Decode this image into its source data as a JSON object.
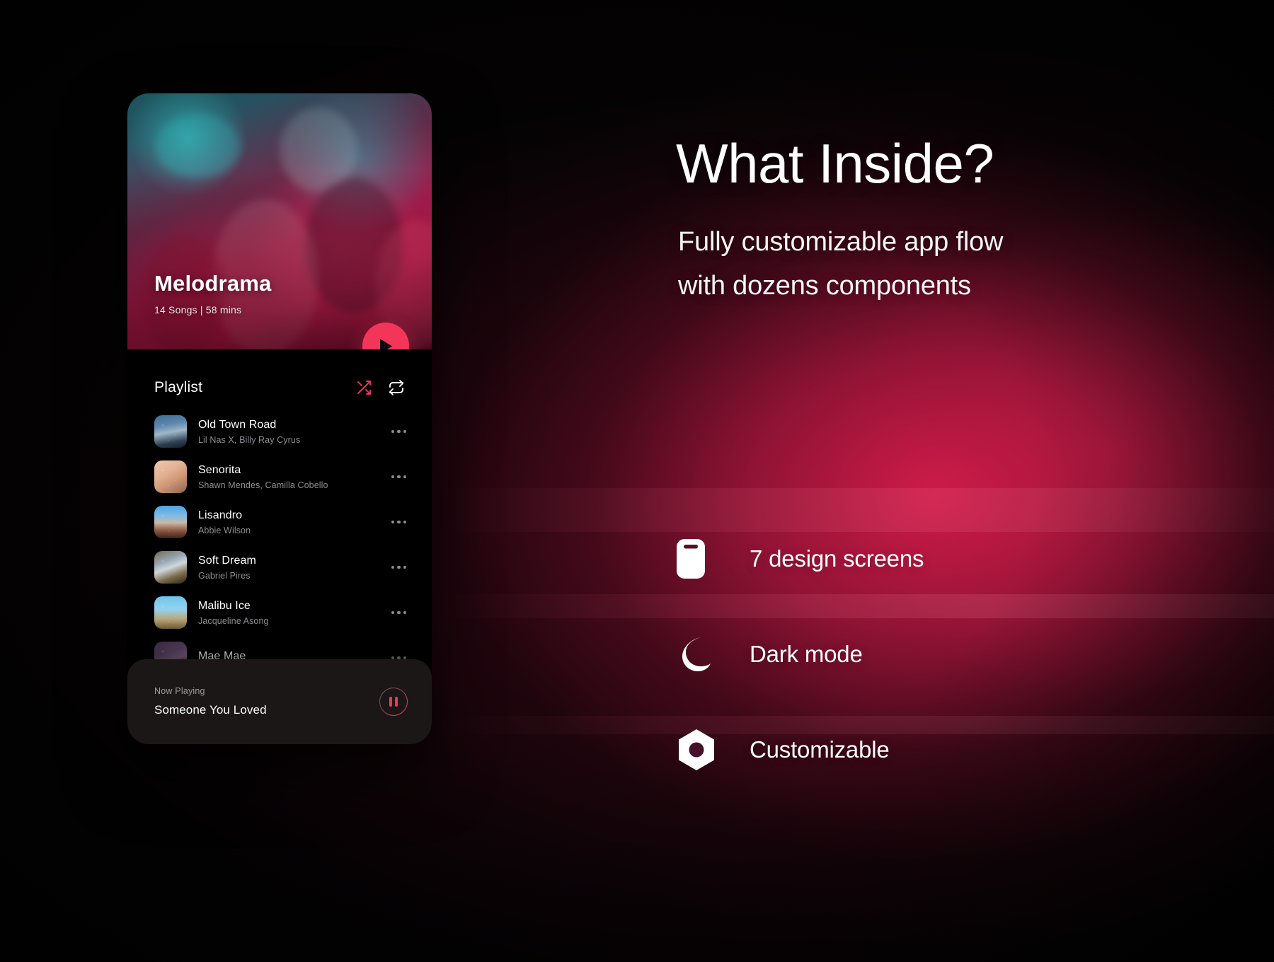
{
  "theme": {
    "accent": "#F4355A",
    "background": "#000000",
    "panel_dark": "#1b1717",
    "text_primary": "#ffffff",
    "text_secondary": "#8d8d92"
  },
  "phone": {
    "hero": {
      "album_title": "Melodrama",
      "album_meta": "14 Songs |  58 mins",
      "play_icon": "play-icon"
    },
    "playlist": {
      "title": "Playlist",
      "shuffle_icon": "shuffle-icon",
      "repeat_icon": "repeat-icon",
      "tracks": [
        {
          "title": "Old Town Road",
          "artist": "Lil Nas X, Billy Ray Cyrus",
          "more_icon": "more-options-icon"
        },
        {
          "title": "Senorita",
          "artist": "Shawn Mendes, Camilla Cobello",
          "more_icon": "more-options-icon"
        },
        {
          "title": "Lisandro",
          "artist": "Abbie Wilson",
          "more_icon": "more-options-icon"
        },
        {
          "title": "Soft Dream",
          "artist": "Gabriel Pires",
          "more_icon": "more-options-icon"
        },
        {
          "title": "Malibu Ice",
          "artist": "Jacqueline Asong",
          "more_icon": "more-options-icon"
        },
        {
          "title": "Mae Mae",
          "artist": "",
          "more_icon": "more-options-icon"
        }
      ]
    },
    "now_playing": {
      "label": "Now Playing",
      "track": "Someone You Loved",
      "pause_icon": "pause-icon"
    }
  },
  "right_panel": {
    "heading": "What Inside?",
    "subheading_line1": "Fully customizable app flow",
    "subheading_line2": "with dozens components",
    "features": [
      {
        "icon": "phone-icon",
        "label": "7 design screens"
      },
      {
        "icon": "moon-icon",
        "label": "Dark mode"
      },
      {
        "icon": "hexagon-nut-icon",
        "label": "Customizable"
      }
    ]
  }
}
